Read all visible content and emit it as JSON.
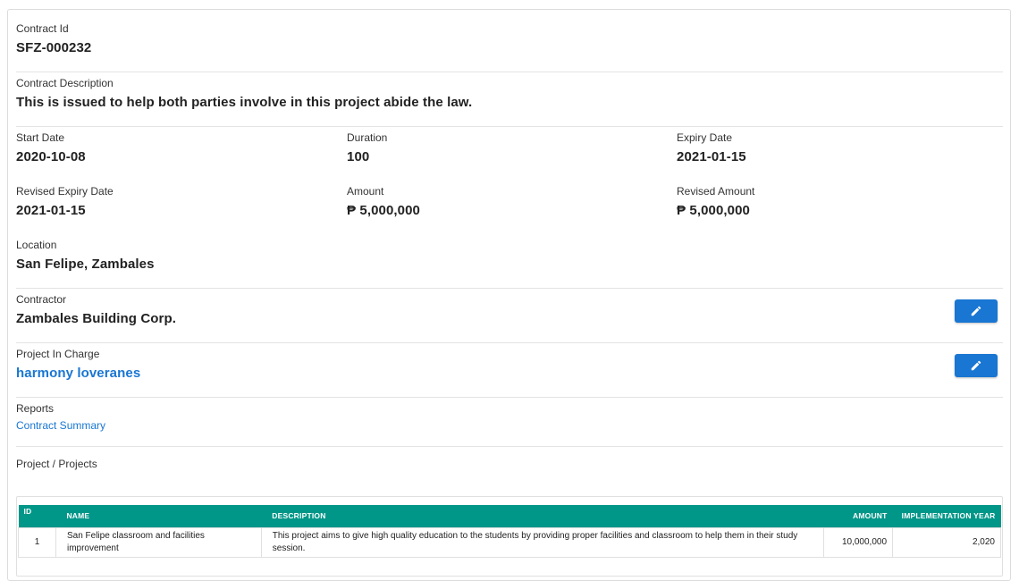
{
  "contract": {
    "id_label": "Contract Id",
    "id_value": "SFZ-000232",
    "description_label": "Contract Description",
    "description_value": "This is issued to help both parties involve in this project abide the law.",
    "start_date_label": "Start Date",
    "start_date_value": "2020-10-08",
    "duration_label": "Duration",
    "duration_value": "100",
    "expiry_date_label": "Expiry Date",
    "expiry_date_value": "2021-01-15",
    "revised_expiry_label": "Revised Expiry Date",
    "revised_expiry_value": "2021-01-15",
    "amount_label": "Amount",
    "amount_value": "₱ 5,000,000",
    "revised_amount_label": "Revised Amount",
    "revised_amount_value": "₱ 5,000,000",
    "location_label": "Location",
    "location_value": "San Felipe, Zambales",
    "contractor_label": "Contractor",
    "contractor_value": "Zambales Building Corp.",
    "pic_label": "Project In Charge",
    "pic_value": "harmony loveranes",
    "reports_label": "Reports",
    "reports_link": "Contract Summary",
    "projects_label": "Project / Projects"
  },
  "table": {
    "headers": {
      "id": "ID",
      "name": "NAME",
      "description": "DESCRIPTION",
      "amount": "AMOUNT",
      "year": "IMPLEMENTATION YEAR"
    },
    "rows": [
      {
        "id": "1",
        "name": "San Felipe classroom and facilities improvement",
        "description": "This project aims to give high quality education to the students by providing proper facilities and classroom to help them in their study session.",
        "amount": "10,000,000",
        "year": "2,020"
      }
    ]
  },
  "colors": {
    "primary": "#1976d2",
    "table_header": "#009688"
  },
  "icons": {
    "edit": "pencil-icon"
  }
}
